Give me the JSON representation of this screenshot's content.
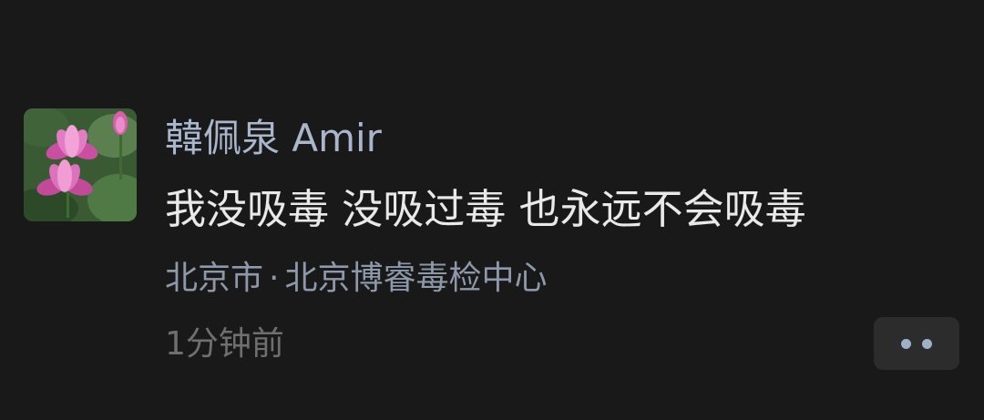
{
  "post": {
    "author": "韓佩泉 Amir",
    "content": "我没吸毒 没吸过毒 也永远不会吸毒",
    "location": {
      "city": "北京市",
      "separator": "·",
      "place": "北京博睿毒检中心"
    },
    "time": "1分钟前"
  },
  "icons": {
    "avatar": "lotus-flower-avatar",
    "more": "ellipsis-more-icon"
  },
  "colors": {
    "background": "#191919",
    "author_name": "#a9b6cc",
    "content_text": "#e9e9e9",
    "location_text": "#8d98ab",
    "time_text": "#6f6f6f",
    "more_button_bg": "#2c2c2c",
    "more_dots": "#9fb0c9"
  }
}
